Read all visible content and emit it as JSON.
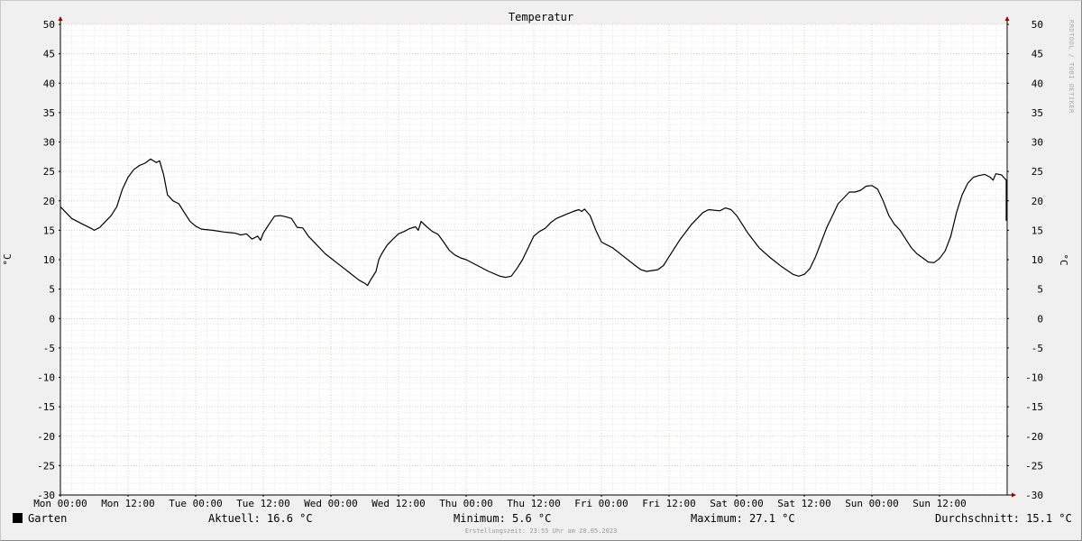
{
  "chart_data": {
    "type": "line",
    "title": "Temperatur",
    "ylabel": "°C",
    "ylim": [
      -30,
      50
    ],
    "yticks": [
      50,
      45,
      40,
      35,
      30,
      25,
      20,
      15,
      10,
      5,
      0,
      -5,
      -10,
      -15,
      -20,
      -25,
      -30
    ],
    "xlim": [
      0,
      168
    ],
    "xtick_labels": [
      "Mon 00:00",
      "Mon 12:00",
      "Tue 00:00",
      "Tue 12:00",
      "Wed 00:00",
      "Wed 12:00",
      "Thu 00:00",
      "Thu 12:00",
      "Fri 00:00",
      "Fri 12:00",
      "Sat 00:00",
      "Sat 12:00",
      "Sun 00:00",
      "Sun 12:00"
    ],
    "grid": true,
    "series": [
      {
        "name": "Garten",
        "color": "#000000",
        "points": [
          [
            0,
            19
          ],
          [
            2,
            17
          ],
          [
            4,
            16
          ],
          [
            5.5,
            15.3
          ],
          [
            6,
            15
          ],
          [
            7,
            15.5
          ],
          [
            9,
            17.5
          ],
          [
            10,
            19
          ],
          [
            11,
            22
          ],
          [
            12,
            24
          ],
          [
            13,
            25.3
          ],
          [
            14,
            26
          ],
          [
            15,
            26.4
          ],
          [
            16,
            27.1
          ],
          [
            17,
            26.5
          ],
          [
            17.6,
            26.8
          ],
          [
            18.3,
            24.5
          ],
          [
            19,
            21
          ],
          [
            20,
            20
          ],
          [
            21,
            19.5
          ],
          [
            22,
            18
          ],
          [
            23,
            16.5
          ],
          [
            24,
            15.7
          ],
          [
            25,
            15.2
          ],
          [
            27,
            15
          ],
          [
            29,
            14.7
          ],
          [
            31,
            14.5
          ],
          [
            32,
            14.2
          ],
          [
            33,
            14.4
          ],
          [
            34,
            13.5
          ],
          [
            35,
            14
          ],
          [
            35.5,
            13.3
          ],
          [
            36,
            14.5
          ],
          [
            37,
            16
          ],
          [
            38,
            17.4
          ],
          [
            39,
            17.5
          ],
          [
            40,
            17.3
          ],
          [
            41,
            17
          ],
          [
            42,
            15.5
          ],
          [
            43,
            15.4
          ],
          [
            44,
            14
          ],
          [
            45,
            13
          ],
          [
            47,
            11
          ],
          [
            49,
            9.5
          ],
          [
            51,
            8
          ],
          [
            53,
            6.5
          ],
          [
            54,
            6
          ],
          [
            54.5,
            5.6
          ],
          [
            55,
            6.5
          ],
          [
            56,
            8
          ],
          [
            56.5,
            10
          ],
          [
            57,
            11
          ],
          [
            58,
            12.5
          ],
          [
            59,
            13.5
          ],
          [
            60,
            14.4
          ],
          [
            61,
            14.8
          ],
          [
            62,
            15.3
          ],
          [
            63,
            15.6
          ],
          [
            63.5,
            15
          ],
          [
            64,
            16.5
          ],
          [
            65,
            15.6
          ],
          [
            66,
            14.8
          ],
          [
            67,
            14.3
          ],
          [
            68,
            13
          ],
          [
            69,
            11.6
          ],
          [
            70,
            10.8
          ],
          [
            71,
            10.3
          ],
          [
            72,
            10
          ],
          [
            74,
            9
          ],
          [
            76,
            8
          ],
          [
            78,
            7.2
          ],
          [
            79,
            7
          ],
          [
            80,
            7.2
          ],
          [
            81,
            8.5
          ],
          [
            82,
            10
          ],
          [
            83,
            12
          ],
          [
            84,
            14
          ],
          [
            85,
            14.8
          ],
          [
            86,
            15.3
          ],
          [
            87,
            16.3
          ],
          [
            88,
            17
          ],
          [
            89,
            17.4
          ],
          [
            90,
            17.8
          ],
          [
            91,
            18.2
          ],
          [
            92,
            18.5
          ],
          [
            92.5,
            18.2
          ],
          [
            93,
            18.6
          ],
          [
            94,
            17.5
          ],
          [
            95,
            15
          ],
          [
            96,
            13
          ],
          [
            97,
            12.5
          ],
          [
            98,
            12
          ],
          [
            100,
            10.5
          ],
          [
            102,
            9
          ],
          [
            103,
            8.3
          ],
          [
            104,
            8
          ],
          [
            106,
            8.3
          ],
          [
            107,
            9
          ],
          [
            108,
            10.5
          ],
          [
            110,
            13.5
          ],
          [
            112,
            16
          ],
          [
            114,
            18
          ],
          [
            115,
            18.5
          ],
          [
            117,
            18.3
          ],
          [
            118,
            18.8
          ],
          [
            119,
            18.5
          ],
          [
            120,
            17.5
          ],
          [
            122,
            14.5
          ],
          [
            124,
            12
          ],
          [
            126,
            10.3
          ],
          [
            128,
            8.8
          ],
          [
            130,
            7.5
          ],
          [
            131,
            7.2
          ],
          [
            132,
            7.5
          ],
          [
            133,
            8.5
          ],
          [
            134,
            10.5
          ],
          [
            135,
            13
          ],
          [
            136,
            15.5
          ],
          [
            137,
            17.5
          ],
          [
            138,
            19.5
          ],
          [
            139,
            20.5
          ],
          [
            140,
            21.5
          ],
          [
            141,
            21.5
          ],
          [
            142,
            21.8
          ],
          [
            143,
            22.5
          ],
          [
            144,
            22.6
          ],
          [
            145,
            22
          ],
          [
            146,
            20
          ],
          [
            147,
            17.5
          ],
          [
            148,
            16
          ],
          [
            149,
            15
          ],
          [
            150,
            13.5
          ],
          [
            151,
            12
          ],
          [
            152,
            11
          ],
          [
            153,
            10.3
          ],
          [
            154,
            9.6
          ],
          [
            155,
            9.5
          ],
          [
            156,
            10.2
          ],
          [
            157,
            11.5
          ],
          [
            158,
            14
          ],
          [
            159,
            18
          ],
          [
            160,
            21
          ],
          [
            161,
            23
          ],
          [
            162,
            24
          ],
          [
            163,
            24.3
          ],
          [
            164,
            24.5
          ],
          [
            165,
            24
          ],
          [
            165.5,
            23.5
          ],
          [
            166,
            24.6
          ],
          [
            167,
            24.4
          ],
          [
            168,
            23.5
          ],
          [
            170,
            21
          ],
          [
            172,
            18
          ],
          [
            173,
            16.6
          ]
        ]
      }
    ]
  },
  "legend": {
    "series_label": "Garten",
    "current": "Aktuell: 16.6 °C",
    "minimum": "Minimum: 5.6 °C",
    "maximum": "Maximum: 27.1 °C",
    "average": "Durchschnitt: 15.1 °C"
  },
  "footer": "Erstellungszeit: 23:55 Uhr am 28.05.2023",
  "watermark": "RRDTOOL / TOBI OETIKER"
}
